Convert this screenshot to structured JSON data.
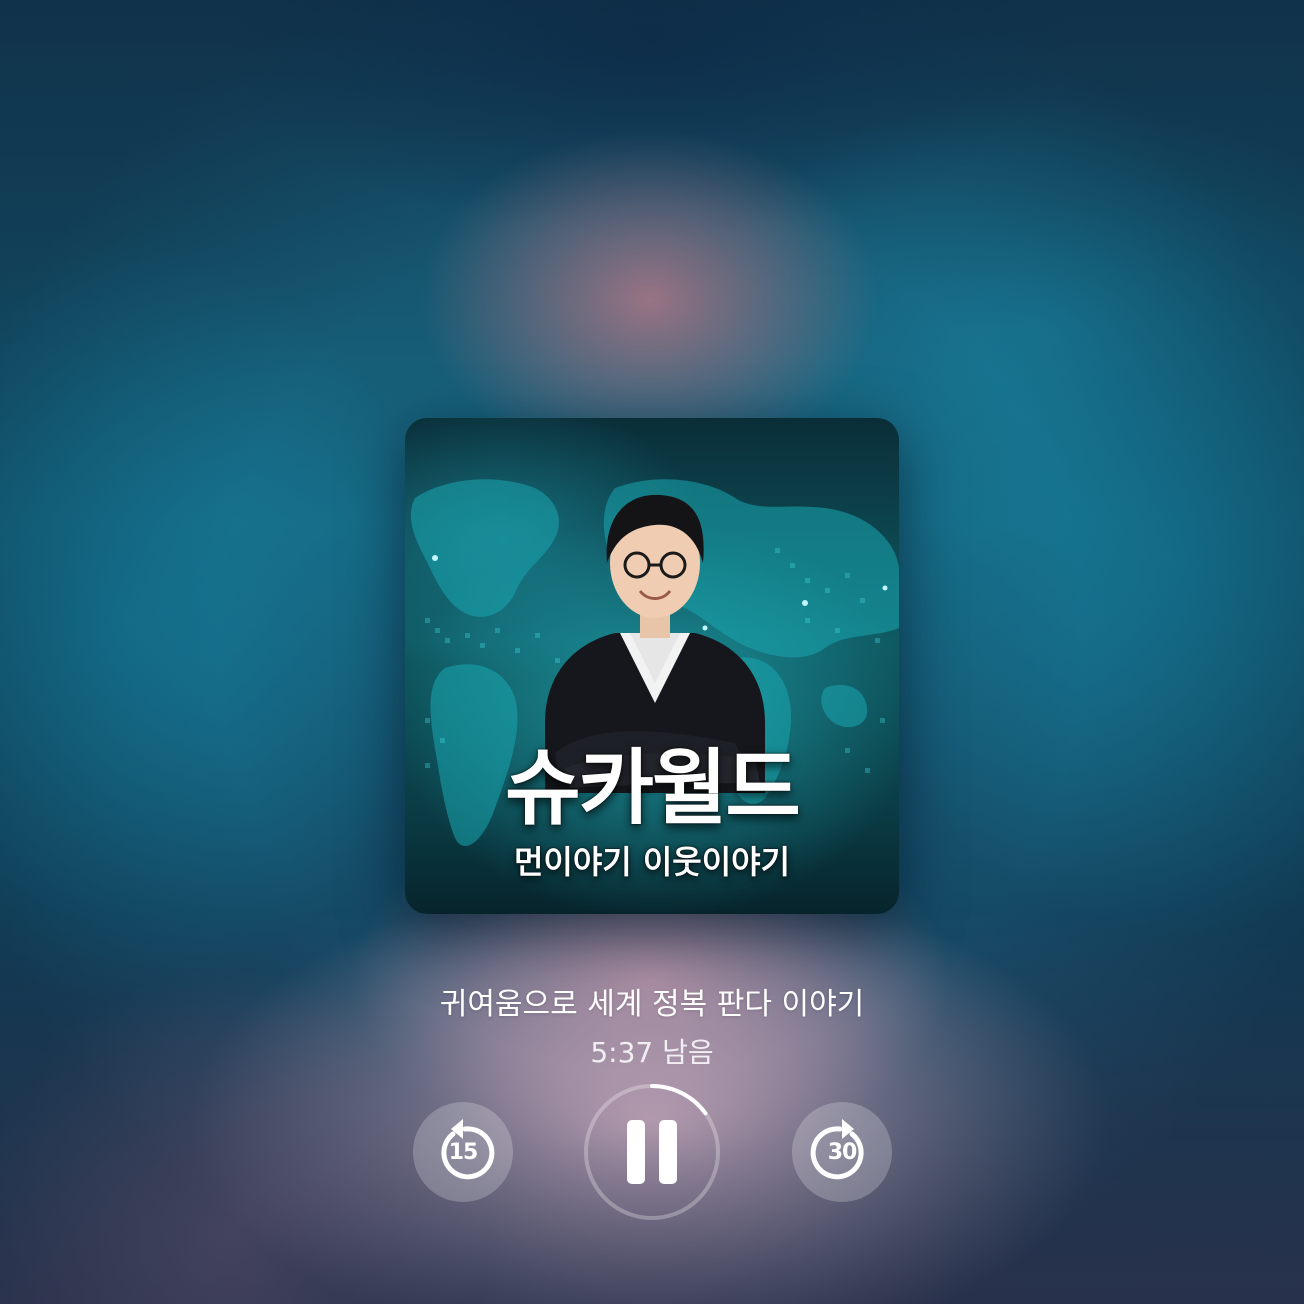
{
  "artwork": {
    "title": "슈카월드",
    "subtitle": "먼이야기 이웃이야기",
    "host_image": "host-portrait",
    "background_image": "world-map"
  },
  "now_playing": {
    "episode_title": "귀여움으로 세계 정복 판다 이야기",
    "time_remaining": "5:37 남음",
    "state": "playing",
    "progress_fraction": 0.15
  },
  "controls": {
    "skip_back": {
      "seconds": "15",
      "icon": "skip-back-15-icon"
    },
    "play_pause": {
      "icon": "pause-icon"
    },
    "skip_forward": {
      "seconds": "30",
      "icon": "skip-forward-30-icon"
    }
  },
  "colors": {
    "text": "#ffffff",
    "control_bg": "rgba(255,255,255,0.22)",
    "artwork_teal": "#0f5a63"
  }
}
